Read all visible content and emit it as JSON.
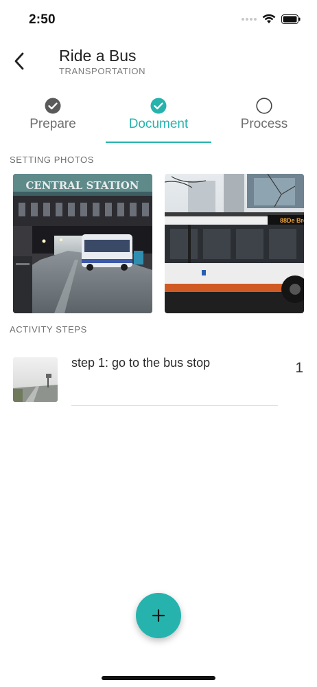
{
  "status_bar": {
    "time": "2:50"
  },
  "header": {
    "title": "Ride a Bus",
    "subtitle": "TRANSPORTATION"
  },
  "tabs": [
    {
      "label": "Prepare",
      "icon": "check-circle-filled-gray",
      "state": "completed"
    },
    {
      "label": "Document",
      "icon": "check-circle-filled-teal",
      "state": "active"
    },
    {
      "label": "Process",
      "icon": "empty-circle",
      "state": "pending"
    }
  ],
  "setting_photos": {
    "label": "SETTING PHOTOS",
    "photos": [
      {
        "name": "central-station-photo",
        "sign_text": "CENTRAL STATION"
      },
      {
        "name": "bus-side-photo",
        "destination_text": "88De Bro"
      }
    ]
  },
  "activity_steps": {
    "label": "ACTIVITY STEPS",
    "items": [
      {
        "text": "step 1: go to the bus stop",
        "number": "1"
      }
    ]
  },
  "colors": {
    "accent": "#26b3ad",
    "text_muted": "#707070"
  }
}
